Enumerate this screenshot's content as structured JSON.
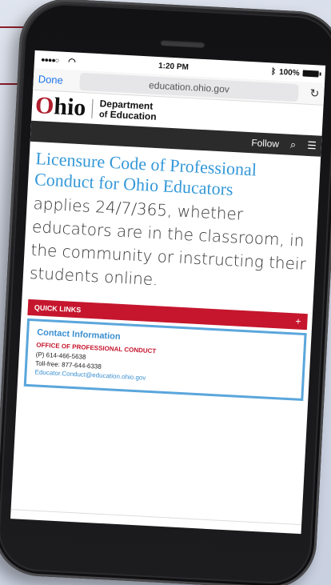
{
  "status_bar": {
    "signal": "●●●●○",
    "wifi_icon": "wifi-icon",
    "time": "1:20 PM",
    "bluetooth_icon": "bluetooth-icon",
    "battery": "100%"
  },
  "browser": {
    "done_label": "Done",
    "url": "education.ohio.gov",
    "reload_icon": "reload-icon"
  },
  "logo": {
    "ohio_first": "O",
    "ohio_rest": "hio",
    "dept_line1": "Department",
    "dept_line2_small": "of",
    "dept_line2": "Education"
  },
  "nav": {
    "follow_label": "Follow",
    "search_icon": "search-icon",
    "menu_icon": "menu-icon"
  },
  "content": {
    "title": "Licensure Code of Professional Conduct for Ohio Educators",
    "lead": "applies 24/7/365, whether educators are in the classroom, in the community or instructing their students online."
  },
  "quick_links": {
    "label": "QUICK LINKS",
    "toggle": "+"
  },
  "contact": {
    "title": "Contact Information",
    "office": "OFFICE OF PROFESSIONAL CONDUCT",
    "phone": "(P) 614-466-5638",
    "tollfree": "Toll-free: 877-644-6338",
    "email": "Educator.Conduct@education.ohio.gov"
  },
  "colors": {
    "brand_red": "#c5162d",
    "link_blue": "#3498d8",
    "background": "#d2d8e6"
  }
}
